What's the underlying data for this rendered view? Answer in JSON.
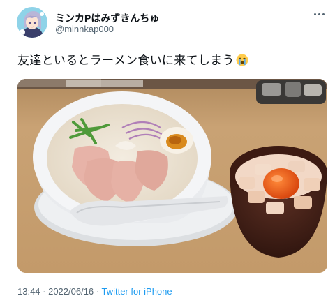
{
  "tweet": {
    "display_name": "ミンカPはみずきんちゅ",
    "handle": "@minnkap000",
    "text": "友達といるとラーメン食いに来てしまう",
    "text_emoji": "loudly-crying-face-emoji",
    "photo_alt_icon": "ramen-photo",
    "timestamp": "13:44 · 2022/06/16 · ",
    "source": "Twitter for iPhone"
  },
  "icons": {
    "more": "more-options-icon",
    "avatar": "avatar-anime-character"
  },
  "colors": {
    "text": "#0f1419",
    "secondary": "#536471",
    "link": "#1d9bf0"
  }
}
